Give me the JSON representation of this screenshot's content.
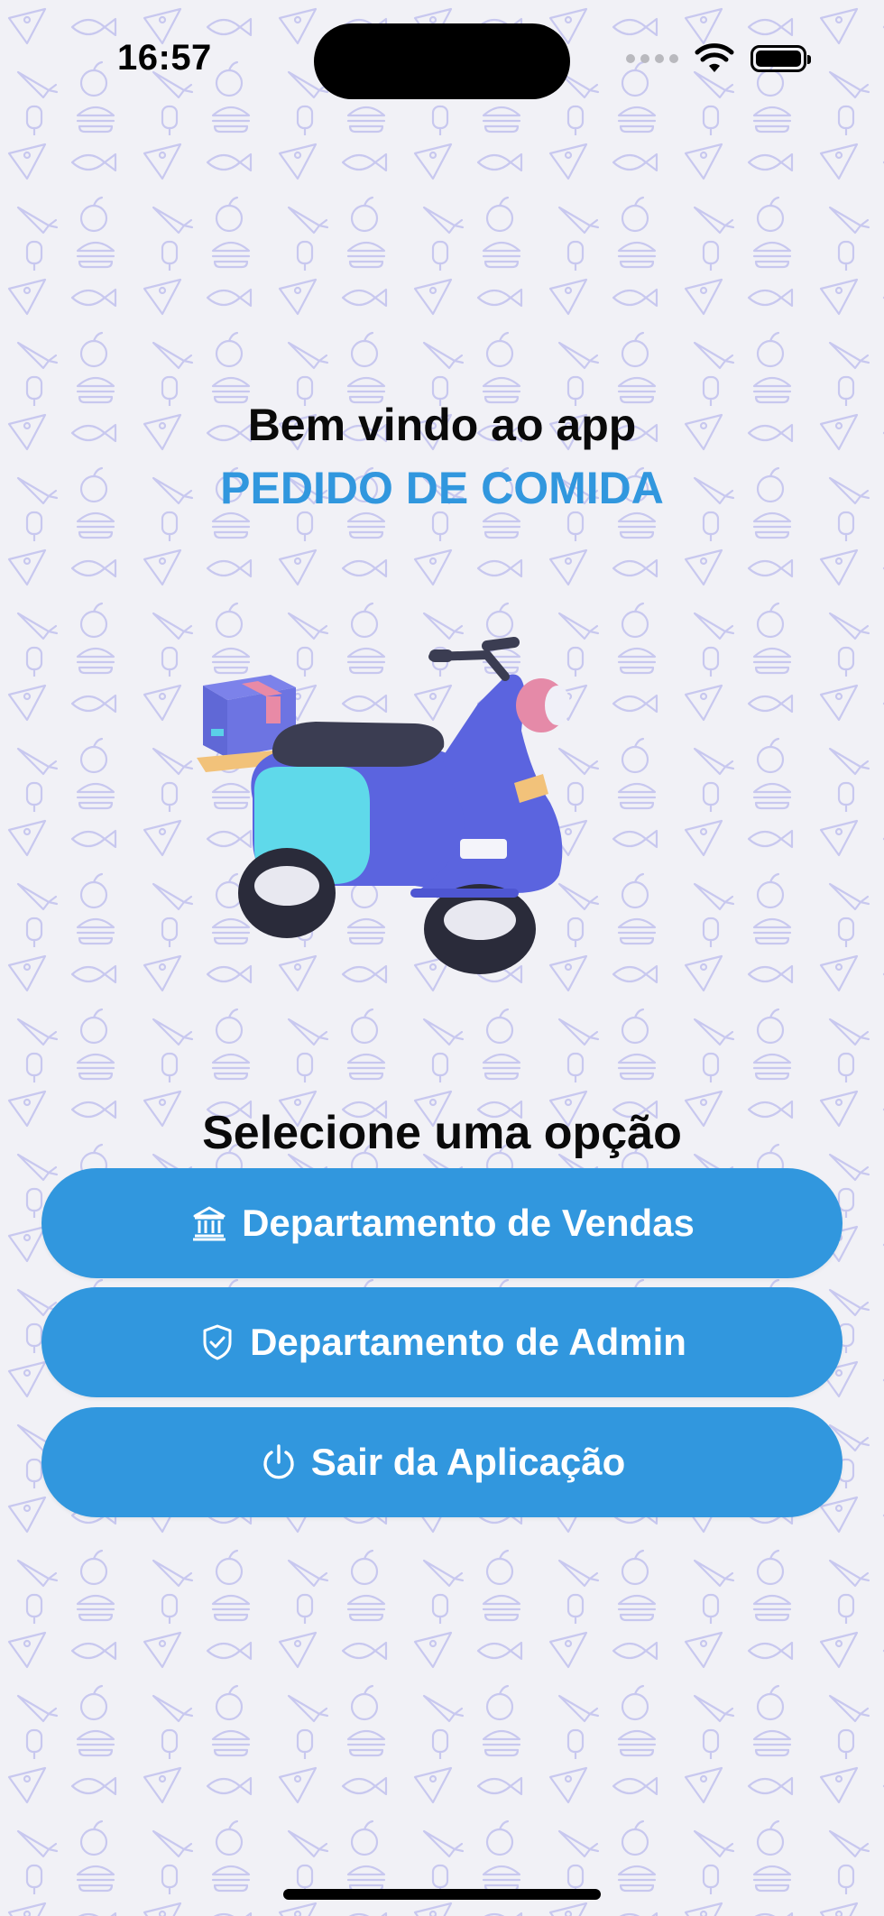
{
  "status_bar": {
    "time": "16:57",
    "icons": [
      "cellular-signal-icon",
      "wifi-icon",
      "battery-icon"
    ]
  },
  "welcome": {
    "line1": "Bem vindo ao app",
    "line2": "PEDIDO DE COMIDA"
  },
  "illustration": "delivery-scooter-with-box",
  "menu": {
    "title": "Selecione uma opção",
    "buttons": [
      {
        "label": "Departamento de Vendas",
        "icon": "bank-icon"
      },
      {
        "label": "Departamento de Admin",
        "icon": "shield-check-icon"
      },
      {
        "label": "Sair da Aplicação",
        "icon": "power-icon"
      }
    ]
  },
  "colors": {
    "accent": "#3197de",
    "background": "#f1f1f6",
    "pattern": "#c9c9f0",
    "text": "#0a0a0a"
  }
}
